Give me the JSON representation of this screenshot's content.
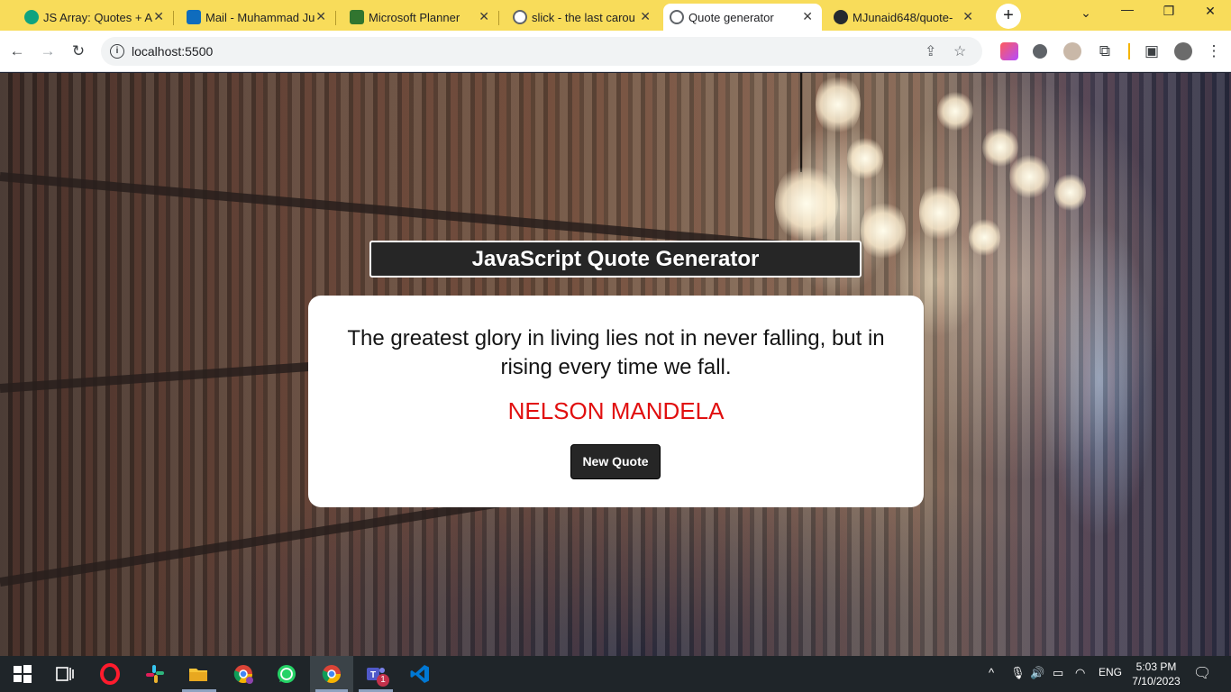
{
  "browser": {
    "tabs": [
      {
        "title": "JS Array: Quotes + A",
        "favicon": "chatgpt-icon",
        "color": "#10a37f",
        "active": false
      },
      {
        "title": "Mail - Muhammad Ju",
        "favicon": "outlook-icon",
        "color": "#0f6cbd",
        "active": false
      },
      {
        "title": "Microsoft Planner",
        "favicon": "planner-icon",
        "color": "#31752f",
        "active": false
      },
      {
        "title": "slick - the last carou",
        "favicon": "globe-icon",
        "color": "#5f6368",
        "active": false
      },
      {
        "title": "Quote generator",
        "favicon": "globe-icon",
        "color": "#5f6368",
        "active": true
      },
      {
        "title": "MJunaid648/quote-",
        "favicon": "github-icon",
        "color": "#24292f",
        "active": false
      }
    ],
    "new_tab_label": "+",
    "tab_close_glyph": "✕",
    "address_bar": {
      "url": "localhost:5500"
    }
  },
  "page": {
    "title": "JavaScript Quote Generator",
    "quote": "The greatest glory in living lies not in never falling, but in rising every time we fall.",
    "author": "NELSON MANDELA",
    "new_quote_label": "New Quote",
    "colors": {
      "author": "#e10f0f",
      "dark": "#262626"
    }
  },
  "taskbar": {
    "apps": [
      "windows-start-icon",
      "task-view-icon",
      "opera-icon",
      "slack-icon",
      "file-explorer-icon",
      "chrome-profile-icon",
      "whatsapp-icon",
      "chrome-icon",
      "teams-icon",
      "vscode-icon"
    ],
    "teams_badge": "1",
    "language": "ENG",
    "time": "5:03 PM",
    "date": "7/10/2023"
  }
}
